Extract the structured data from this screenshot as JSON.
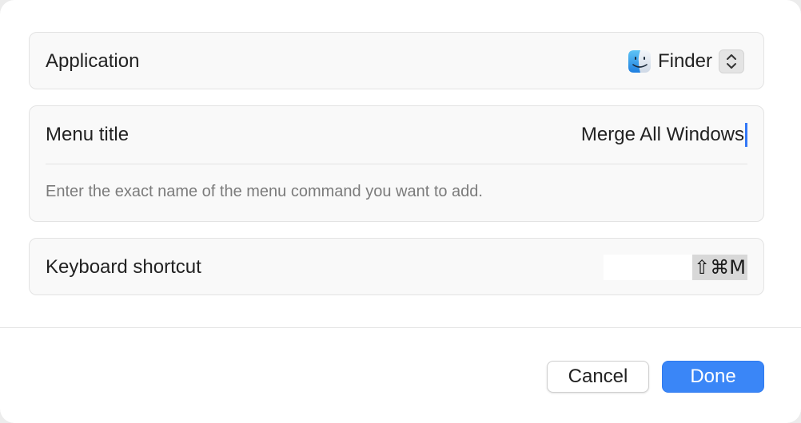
{
  "application": {
    "label": "Application",
    "selected_app": "Finder",
    "app_icon": "finder-icon",
    "stepper_icon": "chevron-up-down-icon"
  },
  "menu_title": {
    "label": "Menu title",
    "value": "Merge All Windows",
    "help_text": "Enter the exact name of the menu command you want to add."
  },
  "keyboard_shortcut": {
    "label": "Keyboard shortcut",
    "value": "⇧⌘M"
  },
  "buttons": {
    "cancel_label": "Cancel",
    "done_label": "Done"
  },
  "colors": {
    "accent": "#3a86f7",
    "caret": "#3478f6"
  }
}
